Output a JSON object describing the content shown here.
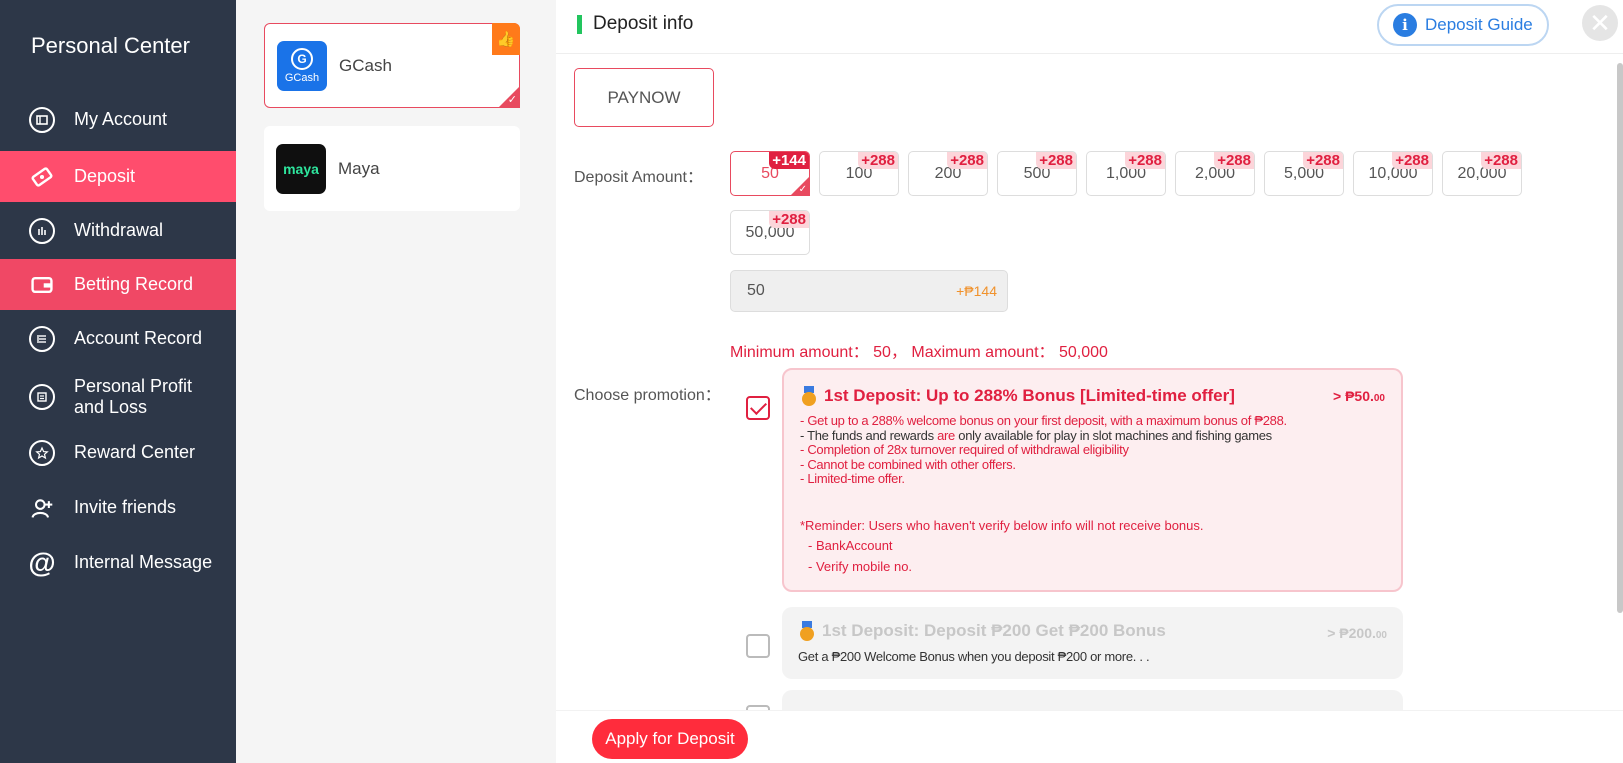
{
  "sidebar": {
    "title": "Personal Center",
    "items": [
      {
        "label": "My Account",
        "icon": "wallet-icon"
      },
      {
        "label": "Deposit",
        "icon": "ticket-icon"
      },
      {
        "label": "Withdrawal",
        "icon": "bars-icon"
      },
      {
        "label": "Betting Record",
        "icon": "card-icon"
      },
      {
        "label": "Account Record",
        "icon": "list-icon"
      },
      {
        "label": "Personal Profit and Loss",
        "icon": "report-icon"
      },
      {
        "label": "Reward Center",
        "icon": "star-icon"
      },
      {
        "label": "Invite friends",
        "icon": "user-add-icon"
      },
      {
        "label": "Internal Message",
        "icon": "at-icon"
      }
    ]
  },
  "channels": [
    {
      "name": "GCash",
      "logo_text": "GCash",
      "selected": true,
      "recommended": true
    },
    {
      "name": "Maya",
      "logo_text": "maya",
      "selected": false
    }
  ],
  "header": {
    "title": "Deposit info",
    "guide_label": "Deposit Guide"
  },
  "colors": {
    "sidebar_bg": "#2d3748",
    "accent_red": "#e02040",
    "active_nav": "#ff4d6d",
    "guide_blue": "#2a7de1",
    "apply_btn": "#ff2c3c"
  },
  "payment_method": "PAYNOW",
  "deposit": {
    "label": "Deposit Amount：",
    "amounts": [
      {
        "value": "50",
        "bonus": "+144",
        "selected": true
      },
      {
        "value": "100",
        "bonus": "+288"
      },
      {
        "value": "200",
        "bonus": "+288"
      },
      {
        "value": "500",
        "bonus": "+288"
      },
      {
        "value": "1,000",
        "bonus": "+288"
      },
      {
        "value": "2,000",
        "bonus": "+288"
      },
      {
        "value": "5,000",
        "bonus": "+288"
      },
      {
        "value": "10,000",
        "bonus": "+288"
      },
      {
        "value": "20,000",
        "bonus": "+288"
      },
      {
        "value": "50,000",
        "bonus": "+288"
      }
    ],
    "input_value": "50",
    "input_bonus": "+₱144",
    "min_max": "Minimum amount： 50， Maximum amount： 50,000"
  },
  "promotion": {
    "label": "Choose promotion：",
    "items": [
      {
        "title": "1st Deposit: Up to 288% Bonus [Limited-time offer]",
        "price": "> ₱50.",
        "price_small": "00",
        "checked": true,
        "lines": [
          "- Get up to a 288% welcome bonus on your first deposit, with a maximum bonus of ₱288.",
          "- The funds and rewards",
          "are",
          "only available for play in slot machines and fishing games",
          "- Completion of 28x turnover required of withdrawal eligibility",
          "- Cannot be combined with other offers.",
          "- Limited-time offer."
        ],
        "reminder": "*Reminder: Users who haven't verify below info will not receive bonus.",
        "requirements": [
          "-  BankAccount",
          "-  Verify mobile no."
        ]
      },
      {
        "title": "1st Deposit: Deposit ₱200 Get ₱200 Bonus",
        "price": "> ₱200.",
        "price_small": "00",
        "checked": false,
        "desc": "Get a ₱200 Welcome Bonus when you deposit ₱200 or more. . ."
      }
    ]
  },
  "apply_label": "Apply for Deposit"
}
